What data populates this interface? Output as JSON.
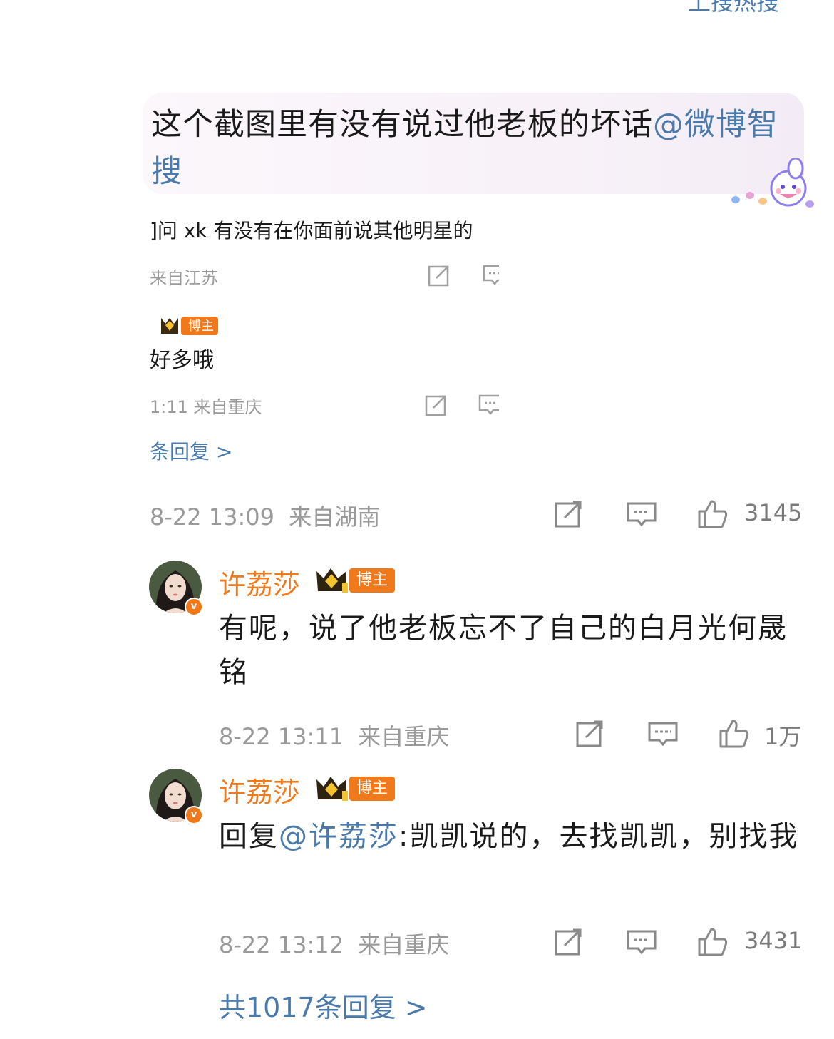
{
  "top_hot_search": "上搜热搜",
  "main_comment": {
    "text": "这个截图里有没有说过他老板的坏话",
    "mention": "@微博智搜",
    "time": "8-22 13:09",
    "location": "来自湖南",
    "likes": "3145"
  },
  "preview": {
    "reply1_text": "]问 xk 有没有在你面前说其他明星的",
    "reply1_meta": "来自江苏",
    "reply2_badge": "博主",
    "reply2_text": "好多哦",
    "reply2_meta": "1:11  来自重庆",
    "more_link": "条回复 >"
  },
  "replies": [
    {
      "username": "许荔莎",
      "badge": "博主",
      "verified": "v",
      "text": "有呢，说了他老板忘不了自己的白月光何晟铭",
      "time": "8-22 13:11",
      "location": "来自重庆",
      "likes": "1万"
    },
    {
      "username": "许荔莎",
      "badge": "博主",
      "verified": "v",
      "prefix": "回复",
      "mention": "@许荔莎",
      "text": ":凯凯说的，去找凯凯，别找我",
      "time": "8-22 13:12",
      "location": "来自重庆",
      "likes": "3431"
    }
  ],
  "total_replies": "共1017条回复 >",
  "colors": {
    "accent": "#4a7aab",
    "brand": "#f07a1b",
    "meta": "#9a9a9a"
  }
}
